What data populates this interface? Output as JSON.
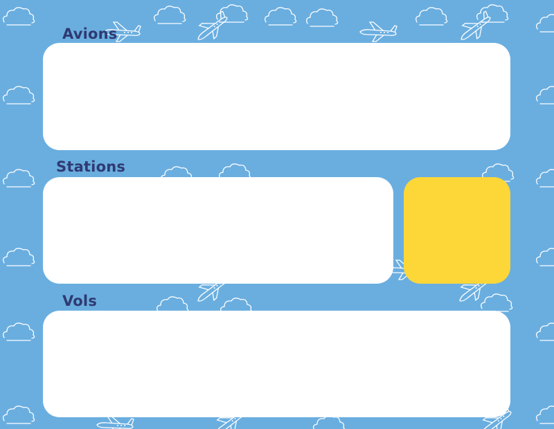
{
  "sections": {
    "avions": {
      "label": "Avions"
    },
    "stations": {
      "label": "Stations"
    },
    "vols": {
      "label": "Vols"
    }
  },
  "colors": {
    "background": "#6aaee0",
    "panel": "#ffffff",
    "accent": "#fdd738",
    "label": "#2f3a72",
    "pattern_line": "#ffffff"
  },
  "pattern_icons": [
    "cloud-icon",
    "airplane-icon"
  ]
}
